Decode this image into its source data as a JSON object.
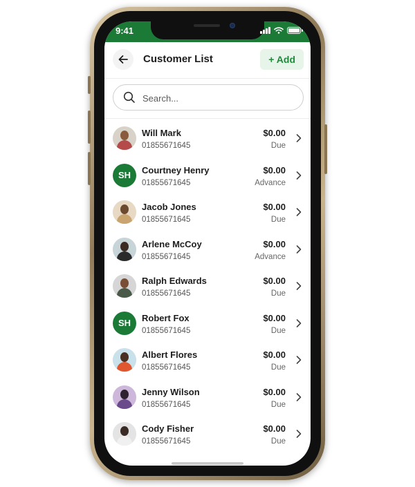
{
  "status_bar": {
    "time": "9:41"
  },
  "header": {
    "title": "Customer List",
    "add_label": "+ Add"
  },
  "search": {
    "placeholder": "Search...",
    "value": ""
  },
  "colors": {
    "accent_green": "#1b7a35",
    "add_button_bg": "#e7f4e9",
    "add_button_text": "#1e8a3a"
  },
  "customers": [
    {
      "name": "Will Mark",
      "phone": "01855671645",
      "amount": "$0.00",
      "status": "Due",
      "avatar": "photo"
    },
    {
      "name": "Courtney Henry",
      "phone": "01855671645",
      "amount": "$0.00",
      "status": "Advance",
      "avatar": "SH"
    },
    {
      "name": "Jacob Jones",
      "phone": "01855671645",
      "amount": "$0.00",
      "status": "Due",
      "avatar": "photo"
    },
    {
      "name": "Arlene McCoy",
      "phone": "01855671645",
      "amount": "$0.00",
      "status": "Advance",
      "avatar": "photo"
    },
    {
      "name": "Ralph Edwards",
      "phone": "01855671645",
      "amount": "$0.00",
      "status": "Due",
      "avatar": "photo"
    },
    {
      "name": "Robert Fox",
      "phone": "01855671645",
      "amount": "$0.00",
      "status": "Due",
      "avatar": "SH"
    },
    {
      "name": "Albert Flores",
      "phone": "01855671645",
      "amount": "$0.00",
      "status": "Due",
      "avatar": "photo"
    },
    {
      "name": "Jenny Wilson",
      "phone": "01855671645",
      "amount": "$0.00",
      "status": "Due",
      "avatar": "photo"
    },
    {
      "name": "Cody Fisher",
      "phone": "01855671645",
      "amount": "$0.00",
      "status": "Due",
      "avatar": "photo"
    }
  ]
}
